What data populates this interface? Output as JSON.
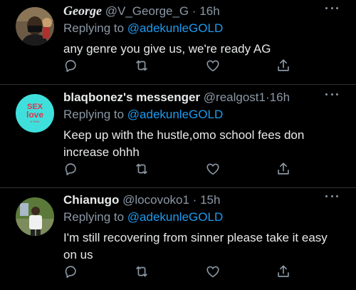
{
  "tweets": [
    {
      "display_name": "George",
      "handle": "@V_George_G",
      "separator": "·",
      "time": "16h",
      "replying_prefix": "Replying to ",
      "replying_to": "@adekunleGOLD",
      "text": "any genre you give us, we're ready AG",
      "avatar_icon": "profile-photo-icon"
    },
    {
      "display_name": "blaqbonez's messenger",
      "handle": "@realgost1",
      "separator": "·",
      "time": "16h",
      "replying_prefix": "Replying to ",
      "replying_to": "@adekunleGOLD",
      "text": "Keep up with the hustle,omo school fees don increase ohhh",
      "avatar_icon": "album-art-avatar-icon",
      "avatar_text_top": "SEX",
      "avatar_text_bottom": "love",
      "avatar_text_small": "& PAIN"
    },
    {
      "display_name": "Chianugo",
      "handle": "@locovoko1",
      "separator": "·",
      "time": "15h",
      "replying_prefix": "Replying to ",
      "replying_to": "@adekunleGOLD",
      "text": "I'm still recovering from sinner please take it easy on us",
      "avatar_icon": "profile-photo-icon"
    }
  ],
  "icons": {
    "reply": "reply-icon",
    "retweet": "retweet-icon",
    "like": "like-icon",
    "share": "share-icon",
    "more": "more-options-icon"
  },
  "colors": {
    "background": "#000000",
    "text_primary": "#e7e9ea",
    "text_secondary": "#8b98a5",
    "mention": "#1d9bf0",
    "divider": "#2f3336"
  }
}
